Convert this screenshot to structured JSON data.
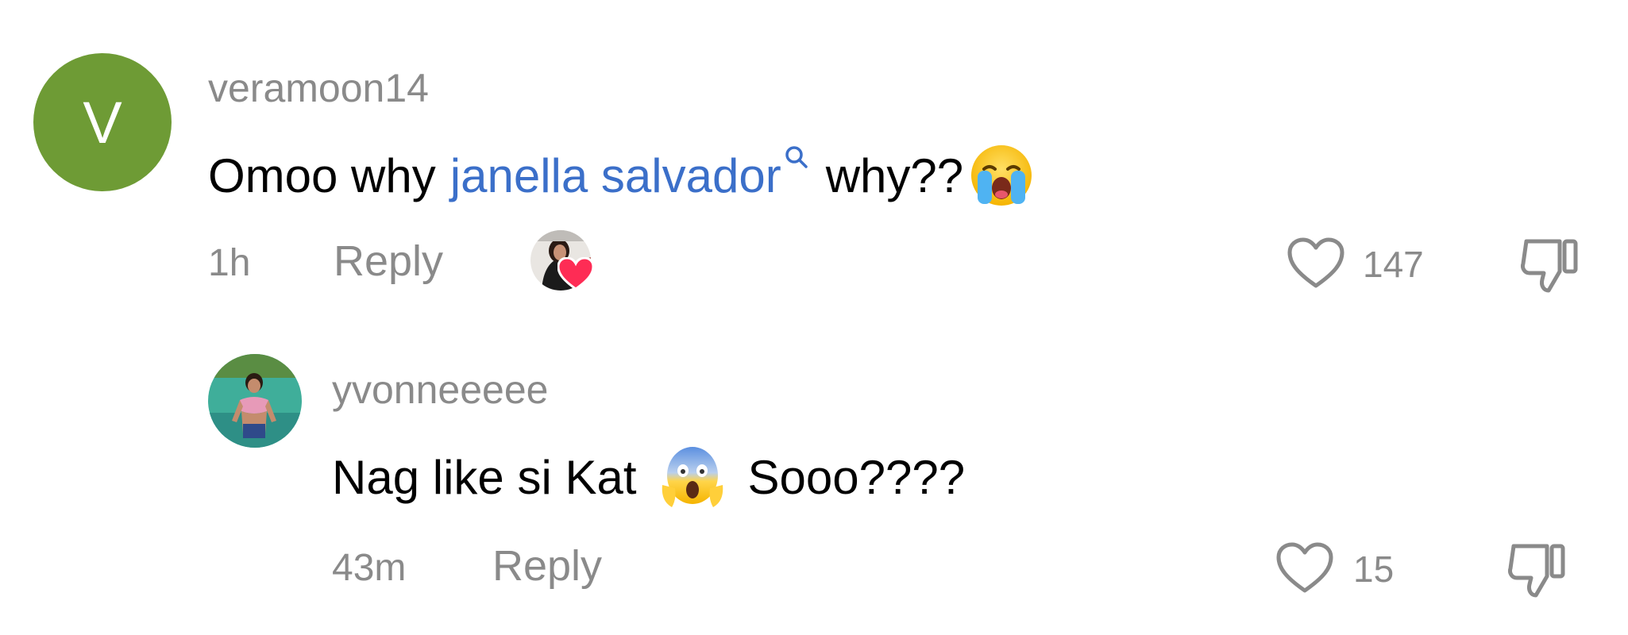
{
  "comments": [
    {
      "avatar_letter": "V",
      "avatar_color": "#6e9b35",
      "username": "veramoon14",
      "text_before": "Omoo why",
      "mention": "janella salvador",
      "text_after": "why??",
      "emoji": "loudly-crying-face",
      "time": "1h",
      "reply_label": "Reply",
      "likes": "147",
      "creator_liked": true
    },
    {
      "username": "yvonneeeee",
      "text_before": "Nag like si Kat",
      "emoji": "face-screaming-in-fear",
      "text_after": "Sooo????",
      "time": "43m",
      "reply_label": "Reply",
      "likes": "15"
    }
  ],
  "colors": {
    "mention": "#3b6fc9",
    "muted": "#8a8a8a",
    "heart_badge": "#fe2c55"
  }
}
